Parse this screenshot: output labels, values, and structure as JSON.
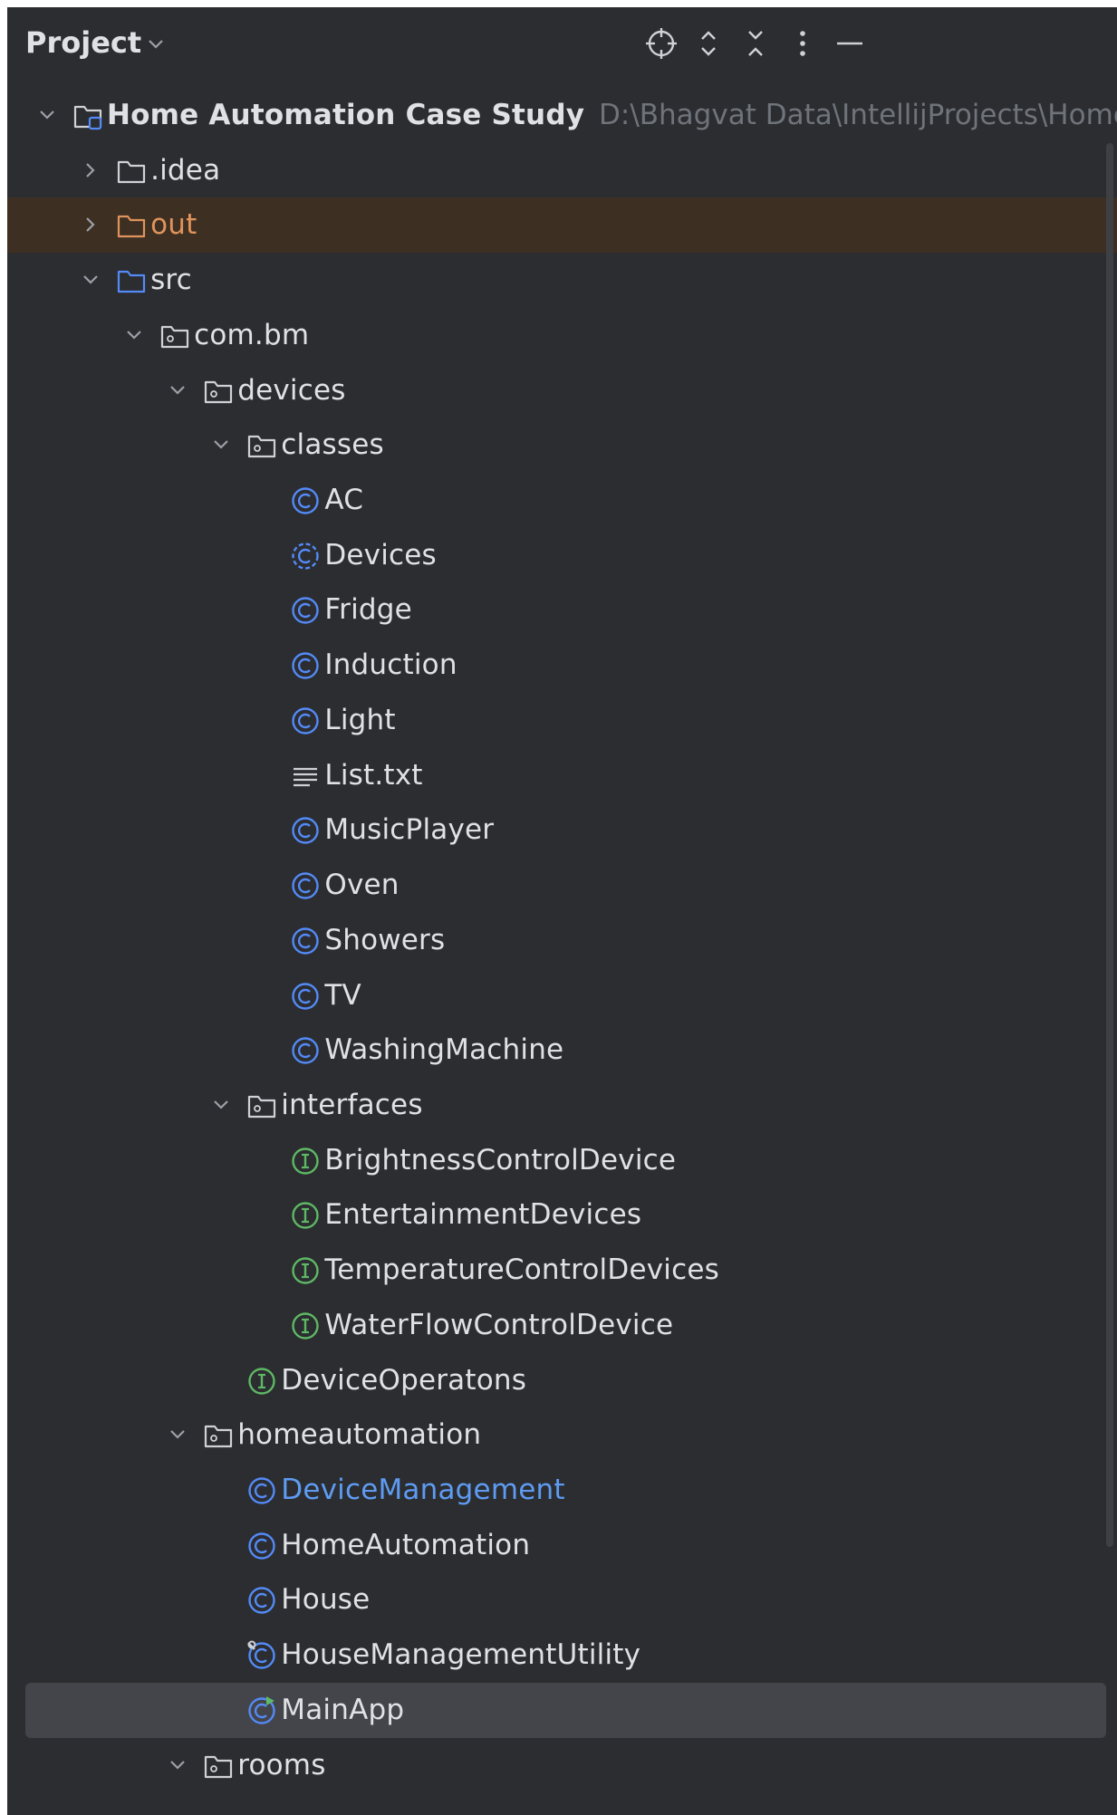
{
  "header": {
    "title": "Project",
    "icons": [
      "locate-icon",
      "expand-all-icon",
      "collapse-all-icon",
      "more-icon",
      "hide-icon"
    ]
  },
  "tree": [
    {
      "label": "Home Automation Case Study",
      "path": "D:\\Bhagvat Data\\IntellijProjects\\Home",
      "depth": 0,
      "chevron": "down",
      "icon": "module-folder",
      "bold": true
    },
    {
      "label": ".idea",
      "depth": 1,
      "chevron": "right",
      "icon": "folder"
    },
    {
      "label": "out",
      "depth": 1,
      "chevron": "right",
      "icon": "excluded-folder",
      "excluded": true
    },
    {
      "label": "src",
      "depth": 1,
      "chevron": "down",
      "icon": "source-folder"
    },
    {
      "label": "com.bm",
      "depth": 2,
      "chevron": "down",
      "icon": "package"
    },
    {
      "label": "devices",
      "depth": 3,
      "chevron": "down",
      "icon": "package"
    },
    {
      "label": "classes",
      "depth": 4,
      "chevron": "down",
      "icon": "package"
    },
    {
      "label": "AC",
      "depth": 5,
      "icon": "class"
    },
    {
      "label": "Devices",
      "depth": 5,
      "icon": "abstract-class"
    },
    {
      "label": "Fridge",
      "depth": 5,
      "icon": "class"
    },
    {
      "label": "Induction",
      "depth": 5,
      "icon": "class"
    },
    {
      "label": "Light",
      "depth": 5,
      "icon": "class"
    },
    {
      "label": "List.txt",
      "depth": 5,
      "icon": "text-file"
    },
    {
      "label": "MusicPlayer",
      "depth": 5,
      "icon": "class"
    },
    {
      "label": "Oven",
      "depth": 5,
      "icon": "class"
    },
    {
      "label": "Showers",
      "depth": 5,
      "icon": "class"
    },
    {
      "label": "TV",
      "depth": 5,
      "icon": "class"
    },
    {
      "label": "WashingMachine",
      "depth": 5,
      "icon": "class"
    },
    {
      "label": "interfaces",
      "depth": 4,
      "chevron": "down",
      "icon": "package"
    },
    {
      "label": "BrightnessControlDevice",
      "depth": 5,
      "icon": "interface"
    },
    {
      "label": "EntertainmentDevices",
      "depth": 5,
      "icon": "interface"
    },
    {
      "label": "TemperatureControlDevices",
      "depth": 5,
      "icon": "interface"
    },
    {
      "label": "WaterFlowControlDevice",
      "depth": 5,
      "icon": "interface"
    },
    {
      "label": "DeviceOperatons",
      "depth": 4,
      "icon": "interface"
    },
    {
      "label": "homeautomation",
      "depth": 3,
      "chevron": "down",
      "icon": "package"
    },
    {
      "label": "DeviceManagement",
      "depth": 4,
      "icon": "class",
      "modified": true
    },
    {
      "label": "HomeAutomation",
      "depth": 4,
      "icon": "class"
    },
    {
      "label": "House",
      "depth": 4,
      "icon": "class"
    },
    {
      "label": "HouseManagementUtility",
      "depth": 4,
      "icon": "class-util"
    },
    {
      "label": "MainApp",
      "depth": 4,
      "icon": "class-runnable",
      "selected": true
    },
    {
      "label": "rooms",
      "depth": 3,
      "chevron": "down",
      "icon": "package"
    }
  ],
  "colors": {
    "background": "#2b2d30",
    "text": "#dfe1e5",
    "muted": "#6f737a",
    "class": "#548af7",
    "interface": "#5fb865",
    "excluded": "#e0935b",
    "selection": "#43454a"
  }
}
